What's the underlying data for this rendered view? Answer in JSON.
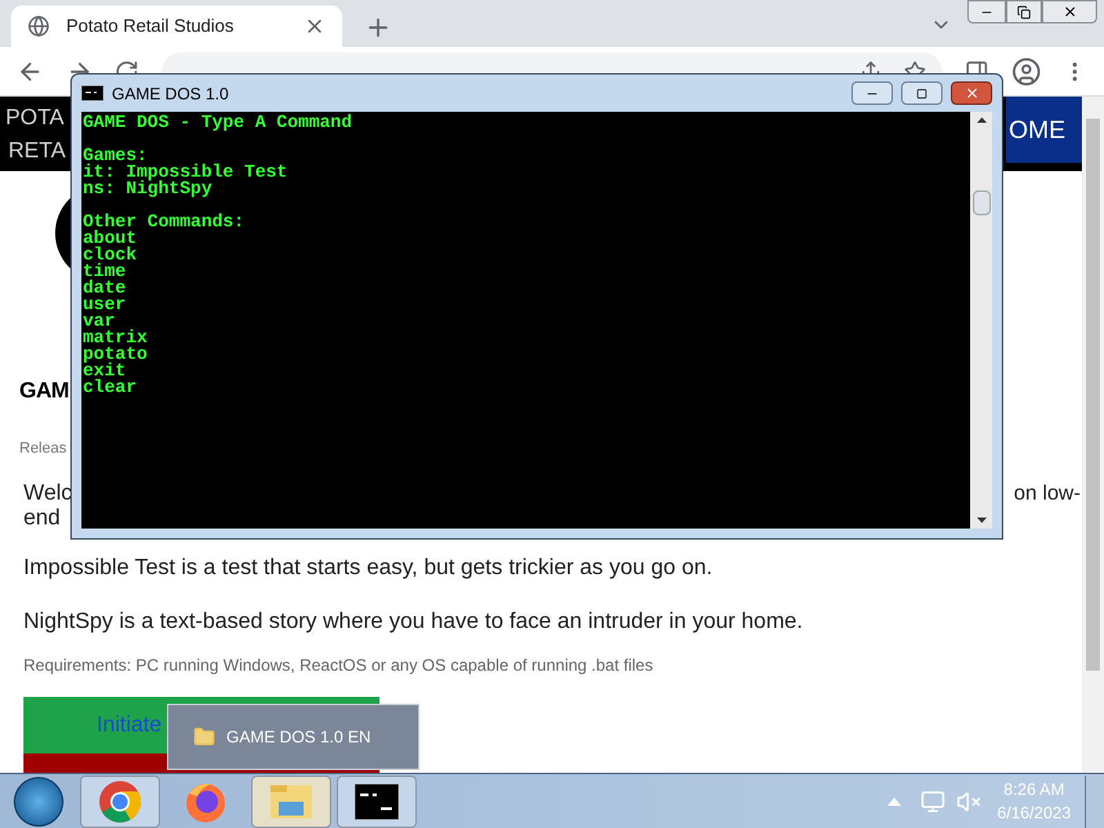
{
  "browser": {
    "tab": {
      "title": "Potato Retail Studios",
      "selected": true
    }
  },
  "page": {
    "header": {
      "logo_lines": [
        "POTA",
        "RETA"
      ],
      "nav_item": "OME"
    },
    "heading": "GAM",
    "release": "Releas",
    "intro": {
      "start": "Welc",
      "end_of_line": "on low-",
      "next_line": "end"
    },
    "paragraphs": [
      "Impossible Test is a test that starts easy, but gets trickier as you go on.",
      "NightSpy is a text-based story where you have to face an intruder in your home."
    ],
    "requirements": "Requirements: PC running Windows, ReactOS or any OS capable of running .bat files",
    "button": "Initiate"
  },
  "console": {
    "title": "GAME DOS 1.0",
    "groups": [
      {
        "lines": [
          "GAME DOS - Type A Command"
        ]
      },
      {
        "lines": [
          "Games:",
          "it: Impossible Test",
          "ns: NightSpy"
        ]
      },
      {
        "lines": [
          "Other Commands:",
          "about",
          "clock",
          "time",
          "date",
          "user",
          "var",
          "matrix",
          "potato",
          "exit",
          "clear"
        ]
      }
    ]
  },
  "taskbar": {
    "apps": [
      {
        "kind": "chrome",
        "open": true
      },
      {
        "kind": "firefox",
        "open": false
      },
      {
        "kind": "explorer",
        "open": true
      },
      {
        "kind": "console",
        "open": true
      }
    ],
    "popup": "GAME DOS 1.0 EN",
    "clock": {
      "time": "8:26 AM",
      "date": "6/16/2023"
    }
  }
}
